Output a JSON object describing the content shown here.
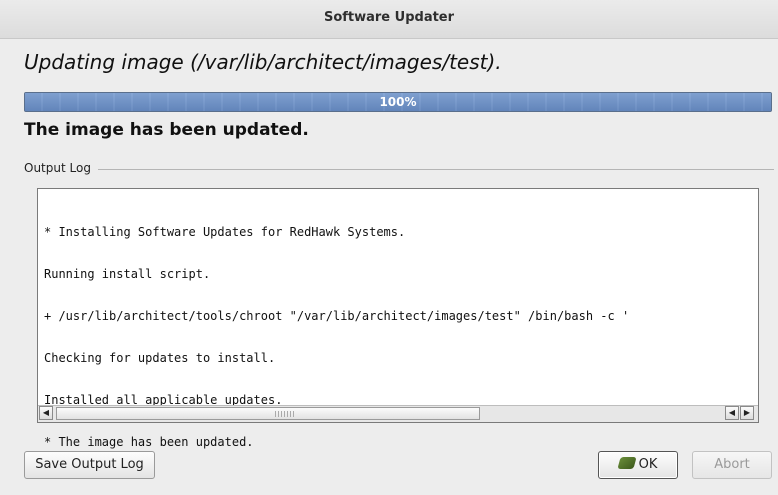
{
  "window": {
    "title": "Software Updater"
  },
  "heading": "Updating image (/var/lib/architect/images/test).",
  "progress": {
    "value": 1.0,
    "label": "100%"
  },
  "status": "The image has been updated.",
  "output_log": {
    "label": "Output Log",
    "lines": [
      "* Installing Software Updates for RedHawk Systems.",
      "Running install script.",
      "+ /usr/lib/architect/tools/chroot \"/var/lib/architect/images/test\" /bin/bash -c '",
      "Checking for updates to install.",
      "Installed all applicable updates.",
      "* The image has been updated."
    ]
  },
  "buttons": {
    "save": "Save Output Log",
    "ok": "OK",
    "abort": "Abort"
  },
  "icons": {
    "ok": "ok-hand-icon",
    "scroll_left": "arrow-left-icon",
    "scroll_right": "arrow-right-icon"
  }
}
